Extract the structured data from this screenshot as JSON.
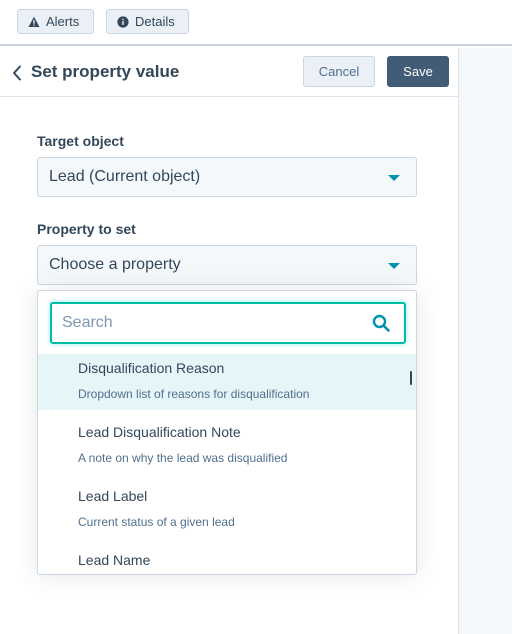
{
  "topbar": {
    "alerts_label": "Alerts",
    "details_label": "Details"
  },
  "panel": {
    "title": "Set property value",
    "cancel_label": "Cancel",
    "save_label": "Save"
  },
  "form": {
    "target_object": {
      "label": "Target object",
      "value": "Lead (Current object)"
    },
    "property_to_set": {
      "label": "Property to set",
      "placeholder": "Choose a property"
    }
  },
  "dropdown": {
    "search_placeholder": "Search",
    "options": [
      {
        "title": "Disqualification Reason",
        "description": "Dropdown list of reasons for disqualification",
        "highlighted": true
      },
      {
        "title": "Lead Disqualification Note",
        "description": "A note on why the lead was disqualified",
        "highlighted": false
      },
      {
        "title": "Lead Label",
        "description": "Current status of a given lead",
        "highlighted": false
      },
      {
        "title": "Lead Name",
        "description": "",
        "highlighted": false
      }
    ]
  },
  "colors": {
    "accent": "#0091ae",
    "focus": "#00bda5",
    "primary_button": "#425b76",
    "highlight_row": "#e5f5f8"
  }
}
